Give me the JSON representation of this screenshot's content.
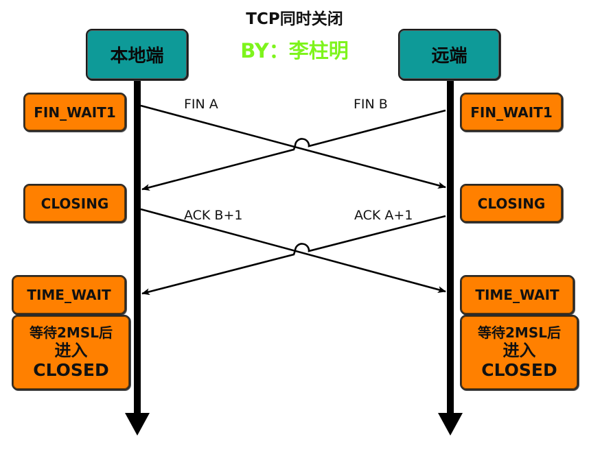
{
  "title": "TCP同时关闭",
  "author": "BY：李柱明",
  "colors": {
    "endpoint_fill": "#0e9a98",
    "state_fill": "#ff8000",
    "author_text": "#7ef41c",
    "line": "#000000"
  },
  "endpoints": {
    "local": "本地端",
    "remote": "远端"
  },
  "local_states": {
    "s1": "FIN_WAIT1",
    "s2": "CLOSING",
    "s3": "TIME_WAIT",
    "s4_line1": "等待2MSL后",
    "s4_line2": "进入",
    "s4_line3": "CLOSED"
  },
  "remote_states": {
    "s1": "FIN_WAIT1",
    "s2": "CLOSING",
    "s3": "TIME_WAIT",
    "s4_line1": "等待2MSL后",
    "s4_line2": "进入",
    "s4_line3": "CLOSED"
  },
  "messages": [
    {
      "label": "FIN A",
      "direction": "local-to-remote"
    },
    {
      "label": "FIN B",
      "direction": "remote-to-local"
    },
    {
      "label": "ACK B+1",
      "direction": "local-to-remote"
    },
    {
      "label": "ACK A+1",
      "direction": "remote-to-local"
    }
  ]
}
